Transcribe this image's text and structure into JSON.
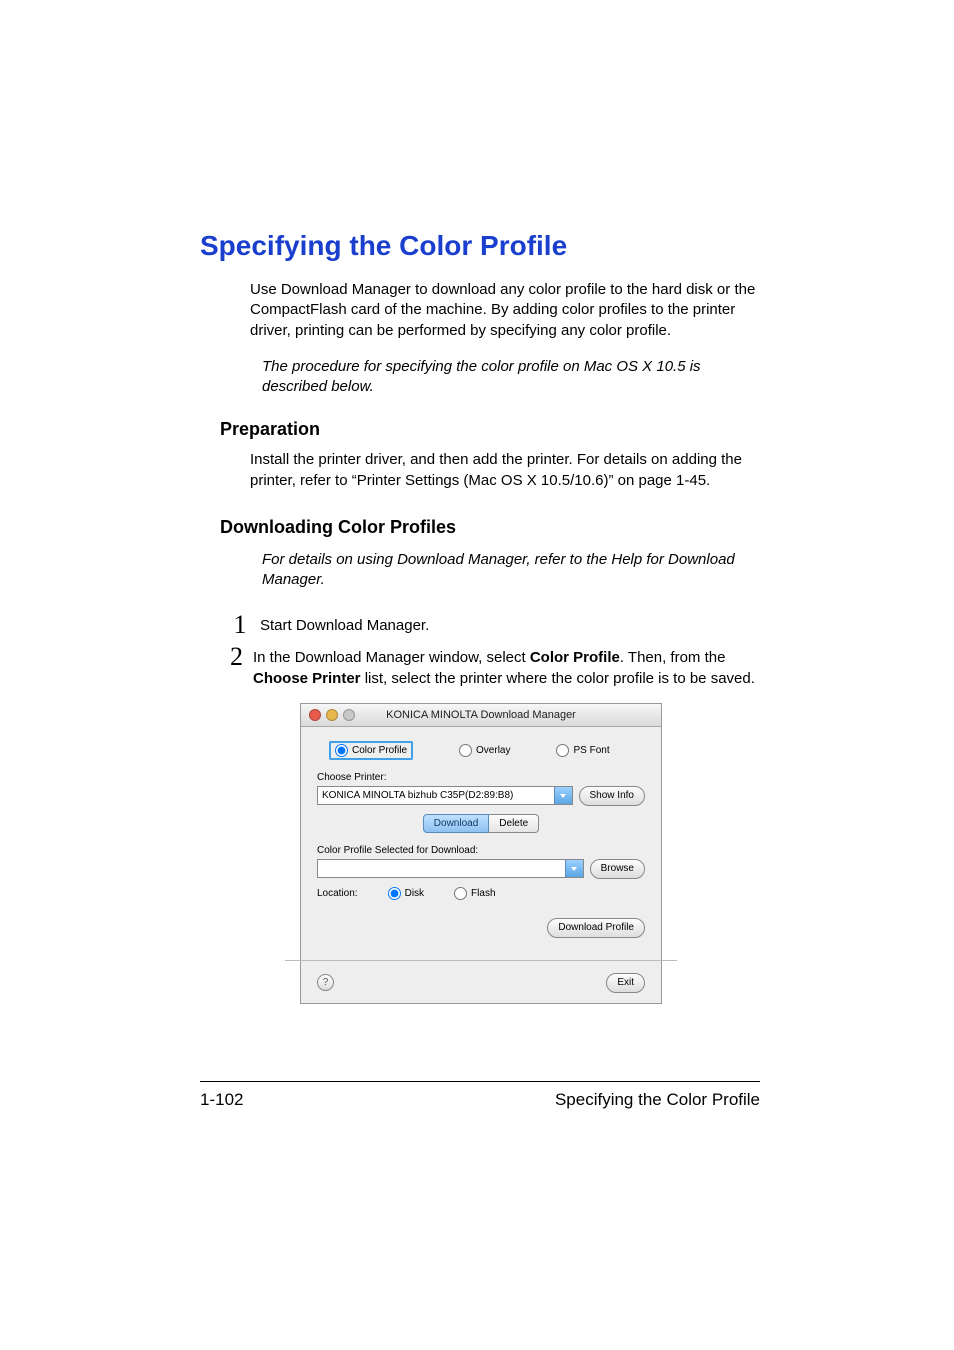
{
  "heading": "Specifying the Color Profile",
  "intro": "Use Download Manager to download any color profile to the hard disk or the CompactFlash card of the machine. By adding color profiles to the printer driver, printing can be performed by specifying any color profile.",
  "note1": "The procedure for specifying the color profile on Mac OS X 10.5 is described below.",
  "sec1_title": "Preparation",
  "sec1_body": "Install the printer driver, and then add the printer. For details on adding the printer, refer to “Printer Settings (Mac OS X 10.5/10.6)” on page 1-45.",
  "sec2_title": "Downloading Color Profiles",
  "note2": "For details on using Download Manager, refer to the Help for Download Manager.",
  "steps": {
    "n1": "1",
    "t1": "Start Download Manager.",
    "n2": "2",
    "t2_a": "In the Download Manager window, select ",
    "t2_bold1": "Color Profile",
    "t2_b": ". Then, from the ",
    "t2_bold2": "Choose Printer",
    "t2_c": " list, select the printer where the color profile is to be saved."
  },
  "screenshot": {
    "title": "KONICA MINOLTA Download Manager",
    "traffic": {
      "red": "#e75b4d",
      "yellow": "#e7b84d",
      "grey": "#c8c8c8"
    },
    "radio_cp": "Color Profile",
    "radio_ov": "Overlay",
    "radio_ps": "PS Font",
    "choose_label": "Choose Printer:",
    "printer_value": "KONICA MINOLTA bizhub C35P(D2:89:B8)",
    "show_info": "Show Info",
    "tab_download": "Download",
    "tab_delete": "Delete",
    "selected_label": "Color Profile Selected for Download:",
    "browse": "Browse",
    "location_label": "Location:",
    "loc_disk": "Disk",
    "loc_flash": "Flash",
    "download_btn": "Download Profile",
    "help": "?",
    "exit": "Exit"
  },
  "footer": {
    "left": "1-102",
    "right": "Specifying the Color Profile"
  }
}
